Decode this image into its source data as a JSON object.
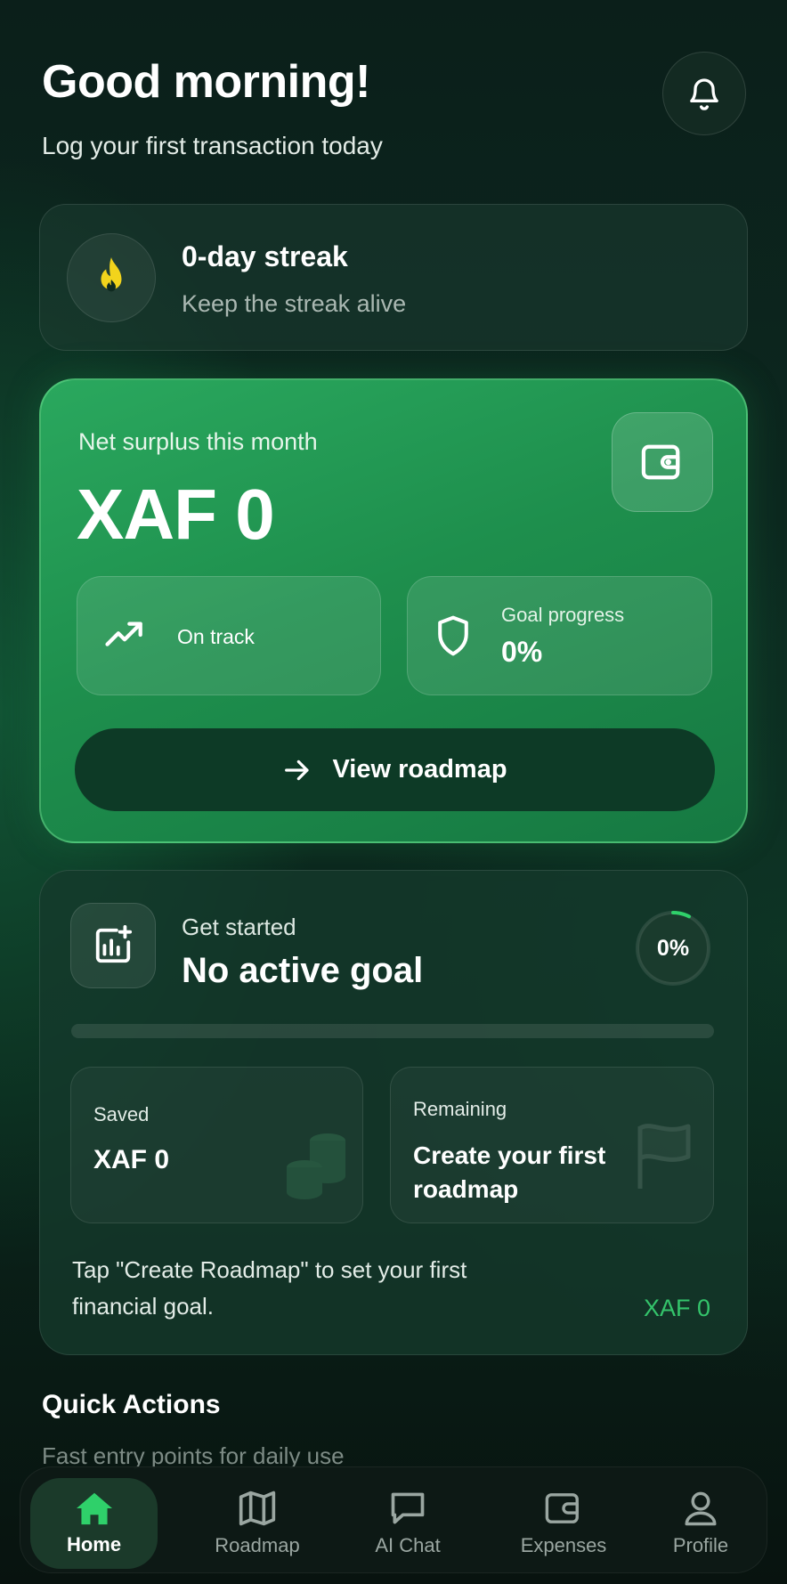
{
  "header": {
    "greeting": "Good morning!",
    "subtitle": "Log your first transaction today",
    "bell_icon": "bell-icon"
  },
  "streak": {
    "title": "0-day streak",
    "subtitle": "Keep the streak alive",
    "icon": "flame-icon",
    "icon_color": "#f2d41c"
  },
  "surplus": {
    "label": "Net surplus this month",
    "amount": "XAF 0",
    "wallet_icon": "wallet-icon",
    "on_track": {
      "label": "On track",
      "icon": "trending-up-icon"
    },
    "goal_progress": {
      "label": "Goal progress",
      "value": "0%",
      "icon": "shield-icon"
    },
    "roadmap_button": {
      "label": "View roadmap",
      "icon": "arrow-right-icon"
    },
    "accent": "#1e8f4d"
  },
  "goal": {
    "eyebrow": "Get started",
    "title": "No active goal",
    "progress_text": "0%",
    "progress_fraction": 0,
    "saved": {
      "label": "Saved",
      "value": "XAF 0"
    },
    "remaining": {
      "label": "Remaining",
      "value": "Create your first roadmap"
    },
    "hint": "Tap \"Create Roadmap\" to set your first financial goal.",
    "amount": "XAF 0",
    "amount_color": "#34c46b"
  },
  "quick_actions": {
    "title": "Quick Actions",
    "subtitle": "Fast entry points for daily use"
  },
  "nav": {
    "items": [
      {
        "label": "Home",
        "icon": "home-icon",
        "active": true
      },
      {
        "label": "Roadmap",
        "icon": "map-icon",
        "active": false
      },
      {
        "label": "AI Chat",
        "icon": "chat-icon",
        "active": false
      },
      {
        "label": "Expenses",
        "icon": "wallet-icon",
        "active": false
      },
      {
        "label": "Profile",
        "icon": "user-icon",
        "active": false
      }
    ],
    "active_color": "#2fd06a"
  }
}
